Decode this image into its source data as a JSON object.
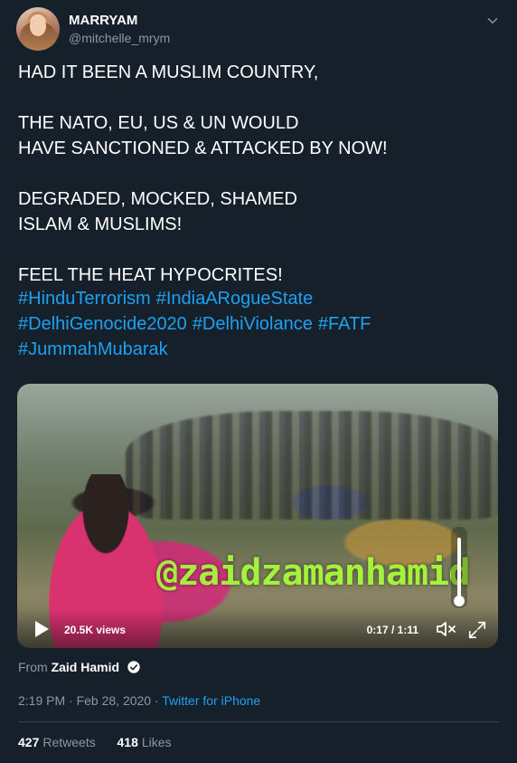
{
  "user": {
    "name": "MARRYAM",
    "handle": "@mitchelle_mrym"
  },
  "tweet": {
    "text": "HAD IT BEEN A MUSLIM COUNTRY,\n\nTHE NATO, EU, US & UN WOULD\nHAVE SANCTIONED & ATTACKED BY NOW!\n\nDEGRADED, MOCKED, SHAMED\nISLAM & MUSLIMS!\n\nFEEL THE HEAT HYPOCRITES!",
    "hashtags": [
      "#HinduTerrorism",
      "#IndiaARogueState",
      "#DelhiGenocide2020",
      "#DelhiViolance",
      "#FATF",
      "#JummahMubarak"
    ]
  },
  "video": {
    "watermark": "@zaidzamanhamid",
    "views": "20.5K views",
    "time": "0:17 / 1:11",
    "volume": 0.8
  },
  "attribution": {
    "prefix": "From",
    "account": "Zaid Hamid"
  },
  "meta": {
    "timestamp": "2:19 PM · Feb 28, 2020 · ",
    "source": "Twitter for iPhone"
  },
  "stats": {
    "retweets_count": "427",
    "retweets_label": "Retweets",
    "likes_count": "418",
    "likes_label": "Likes"
  },
  "colors": {
    "background": "#15202b",
    "link": "#1da1f2",
    "muted": "#8899a6"
  },
  "icons": [
    "chevron-down-icon",
    "play-icon",
    "mute-icon",
    "expand-icon",
    "verified-badge-icon"
  ]
}
